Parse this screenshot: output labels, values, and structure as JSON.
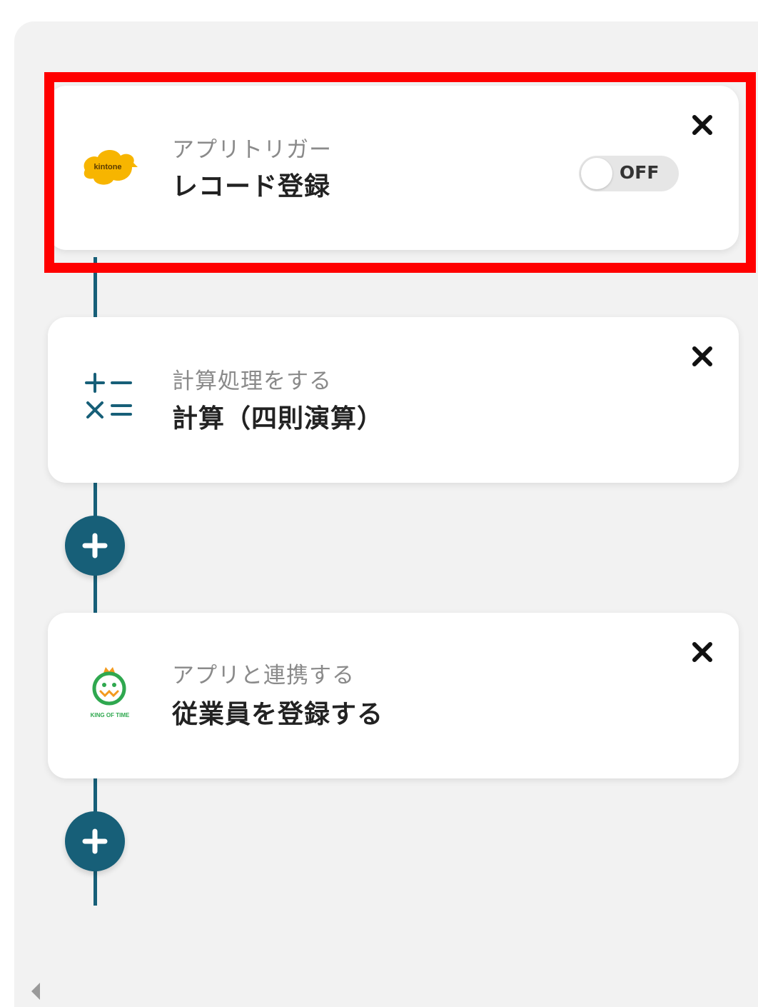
{
  "steps": [
    {
      "subtitle": "アプリトリガー",
      "title": "レコード登録",
      "icon": "kintone-logo-icon",
      "icon_text": "kintone",
      "toggle_label": "OFF",
      "close_icon": "close-icon"
    },
    {
      "subtitle": "計算処理をする",
      "title": "計算（四則演算）",
      "icon": "calculator-operators-icon",
      "close_icon": "close-icon"
    },
    {
      "subtitle": "アプリと連携する",
      "title": "従業員を登録する",
      "icon": "king-of-time-logo-icon",
      "icon_text": "KING OF TIME",
      "close_icon": "close-icon"
    }
  ],
  "add_button_icon": "plus-icon",
  "colors": {
    "accent": "#175f78",
    "highlight": "#ff0000",
    "panel": "#f2f2f2",
    "kintone": "#f7b500",
    "kingoftime": "#2fa84f"
  }
}
